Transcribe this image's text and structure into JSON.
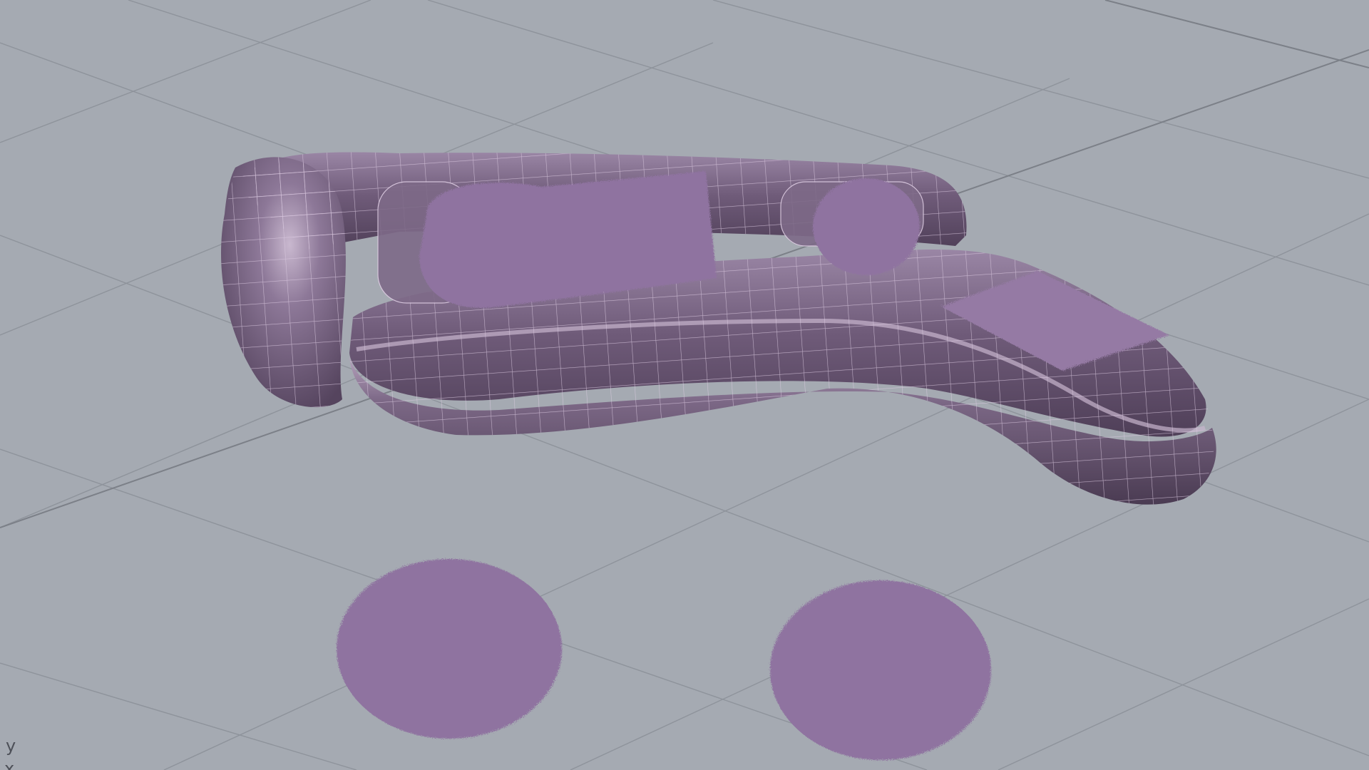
{
  "viewport": {
    "name": "Perspective",
    "background": "#a5aab2",
    "grid_color": "#8e939b",
    "grid_major_color": "#7c8088"
  },
  "scene": {
    "sofa_color": "#75617f",
    "sofa_highlight": "#b7a3be",
    "wireframe_color": "#d9c9de",
    "fur_color": "#8f73a0",
    "objects": [
      "curved-sectional-sofa",
      "fur-cushion-left",
      "fur-cushion-round",
      "fur-throw-blanket",
      "fur-pouf-left",
      "fur-pouf-right"
    ]
  },
  "axes": {
    "y_label": "y",
    "x_label": "x"
  }
}
